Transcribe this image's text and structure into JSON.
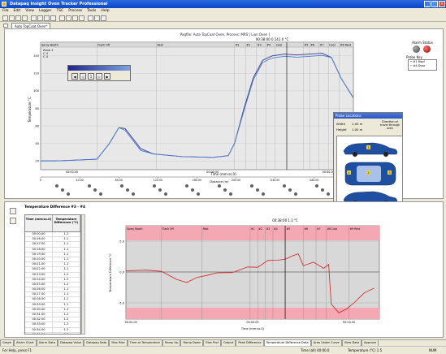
{
  "window": {
    "title": "Datapaq Insight Oven Tracker Professional"
  },
  "menu": [
    "File",
    "Edit",
    "View",
    "Logger",
    "TSC",
    "Process",
    "Tools",
    "Help"
  ],
  "doc_tab": "Auto TopCoat Oven*",
  "top_chart": {
    "title": "Paqfile: Auto TopCoat Oven, Process: MRS [ Lion Oven ]",
    "cursor_readout": "00:38:00.0 141.0 °C",
    "cursor_time": "00:38:00.0",
    "ylabel": "Temperature °C",
    "xlabel": "Time (mm:ss.0)",
    "x_sublabel": "Distance (m)",
    "legend_a": "Zone 1",
    "legend_b": "C 4",
    "legend_c": "C 4",
    "zones": [
      "Spray Booth",
      "Flash Off",
      "Rest",
      "#1",
      "#2",
      "#3",
      "#4",
      "Cool",
      "#5",
      "#6",
      "#7",
      "Cool",
      "#8 Rest"
    ],
    "yticks": [
      "20",
      "40",
      "60",
      "80",
      "100",
      "120",
      "140"
    ],
    "xticks": [
      "00:00.00",
      "40:00.00",
      "80:00.00",
      "120:00.00",
      "160:00.00",
      "200:00.00",
      "240:00.00",
      "280:00.00",
      "320:00.00"
    ],
    "xticks_time": [
      "00:00.00",
      "00:00.00",
      "00:00.00"
    ],
    "distance_ticks": [
      "0",
      "40.00",
      "80.00",
      "120.00",
      "160.00",
      "200.00",
      "240.00",
      "280.00",
      "320.00"
    ],
    "series": [
      {
        "name": "#1 Roof",
        "color": "#3a3a90"
      },
      {
        "name": "#4 Door",
        "color": "#4a7ad0"
      }
    ]
  },
  "status_panel": {
    "alarm_label": "Alarm Status",
    "probe_label": "Probe Key",
    "probes": [
      "#1 Roof",
      "#4 Door"
    ]
  },
  "toolbox": {
    "buttons": [
      "◀",
      "◁",
      "▷",
      "▶"
    ],
    "counter": "1"
  },
  "popup": {
    "title": "Probe Locations",
    "width_label": "Width",
    "width_value": "1.00 m",
    "height_label": "Height",
    "height_value": "1.00 m",
    "direction_label": "Direction of travel through oven",
    "car_markers": [
      "1",
      "4",
      "2",
      "3"
    ]
  },
  "bottom_table": {
    "title": "Temperature Difference #3 - #4",
    "col_time": "Time (mm:ss.0)",
    "col_diff": "Temperature Difference (°C)",
    "rows": [
      [
        "00:00.00",
        "1.2"
      ],
      [
        "00:16.00",
        "1.1"
      ],
      [
        "00:17.00",
        "1.1"
      ],
      [
        "00:18.00",
        "1.1"
      ],
      [
        "00:19.00",
        "1.1"
      ],
      [
        "00:20.00",
        "1.1"
      ],
      [
        "00:21.00",
        "1.1"
      ],
      [
        "00:22.00",
        "1.1"
      ],
      [
        "00:23.00",
        "1.2"
      ],
      [
        "00:24.00",
        "1.2"
      ],
      [
        "00:25.00",
        "1.2"
      ],
      [
        "00:26.00",
        "1.1"
      ],
      [
        "00:27.00",
        "1.1"
      ],
      [
        "00:28.00",
        "1.1"
      ],
      [
        "00:29.00",
        "1.1"
      ],
      [
        "00:30.00",
        "1.1"
      ],
      [
        "00:31.00",
        "1.2"
      ],
      [
        "00:32.00",
        "1.2"
      ],
      [
        "00:33.00",
        "1.2"
      ],
      [
        "00:34.00",
        "1.2"
      ],
      [
        "00:35.00",
        "1.2"
      ],
      [
        "00:36.00",
        "1.1"
      ],
      [
        "00:37.00",
        "1.2"
      ],
      [
        "00:38.00",
        "1.2"
      ],
      [
        "00:39.00",
        "1.2"
      ],
      [
        "00:40.00",
        "1.2"
      ],
      [
        "00:41.00",
        "1.2"
      ]
    ]
  },
  "bottom_chart": {
    "cursor_readout": "00:38:00 1.2 °C",
    "ylabel": "Temperature Difference °C",
    "xlabel": "Time (mm:ss.0)",
    "zones": [
      "Spray Booth",
      "Flash Off",
      "Rest",
      "#1",
      "#2",
      "#3",
      "#4",
      "#5",
      "#6",
      "#7",
      "#8 Cool",
      "#9 Rest"
    ],
    "yticks": [
      "5.0",
      "0.0",
      "-5.0"
    ],
    "xticks": [
      "00:00.00",
      "00:00.00",
      "00:00.00"
    ],
    "line_color": "#d02020",
    "band_color": "#f4a8b4"
  },
  "bottom_tabs": [
    "Graph",
    "Alarm Chart",
    "Alarm Data",
    "Datapaq Value",
    "Datapaq Data",
    "Max Rise",
    "Time at Temperature",
    "Ramp Up",
    "Ramp Down",
    "Rise Prof",
    "Output",
    "Peak Difference",
    "Temperature Difference Data",
    "Area Under Curve",
    "View Data",
    "Approve"
  ],
  "active_bottom_tab": "Temperature Difference Data",
  "statusbar": {
    "help": "For Help, press F1",
    "time": "Time (all) 40:00.0",
    "temp": "Temperature (°C) 1.5",
    "num": "NUM"
  }
}
